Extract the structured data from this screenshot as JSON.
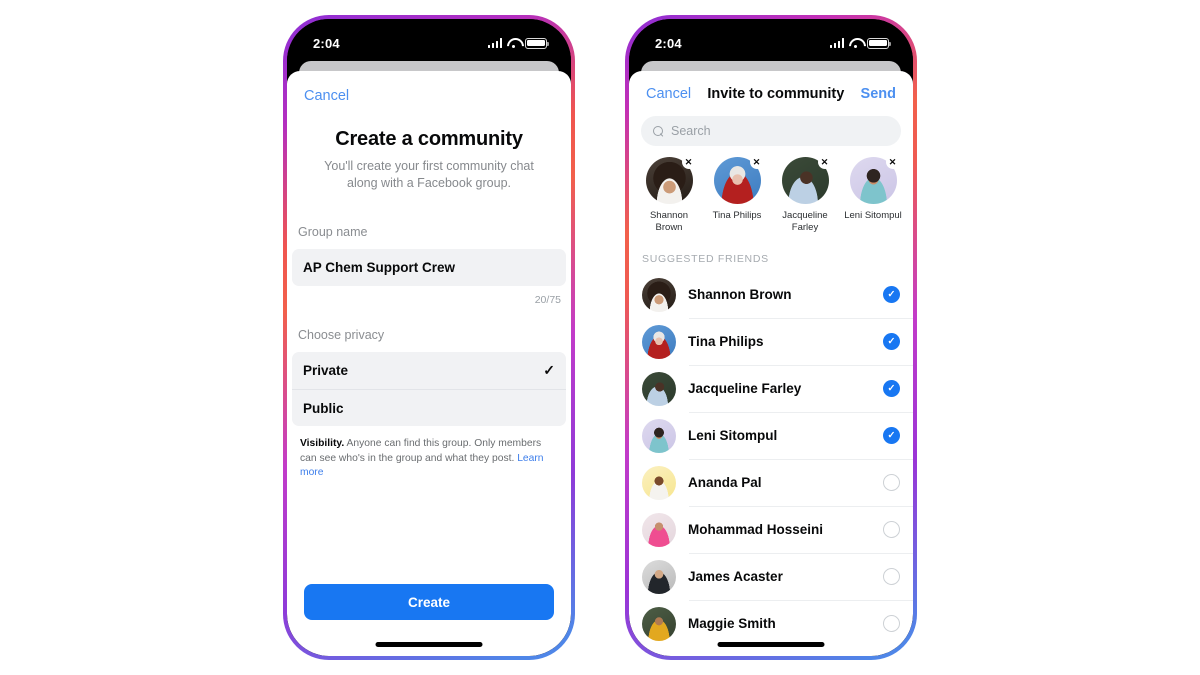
{
  "left_phone": {
    "status_bar": {
      "time": "2:04",
      "signal_icon": "cellular-bars-icon",
      "wifi_icon": "wifi-icon",
      "battery_icon": "battery-icon"
    },
    "nav": {
      "cancel_label": "Cancel"
    },
    "title": "Create a community",
    "subtitle": "You'll create your first community chat along with a Facebook group.",
    "group_name": {
      "label": "Group name",
      "value": "AP Chem Support Crew",
      "counter": "20/75"
    },
    "privacy": {
      "label": "Choose privacy",
      "options": [
        {
          "label": "Private",
          "selected": true,
          "check_glyph": "✓"
        },
        {
          "label": "Public",
          "selected": false,
          "check_glyph": ""
        }
      ]
    },
    "visibility_note": {
      "bold": "Visibility.",
      "text": " Anyone can find this group. Only members can see who's in the group and what they post. ",
      "link": "Learn more"
    },
    "primary_button": "Create",
    "accent_color": "#1877f2",
    "link_color": "#4d90f0"
  },
  "right_phone": {
    "status_bar": {
      "time": "2:04",
      "signal_icon": "cellular-bars-icon",
      "wifi_icon": "wifi-icon",
      "battery_icon": "battery-icon"
    },
    "nav": {
      "cancel_label": "Cancel",
      "title": "Invite to community",
      "send_label": "Send"
    },
    "search": {
      "placeholder": "Search",
      "icon": "search-icon"
    },
    "selected_chips": [
      {
        "name": "Shannon Brown",
        "remove_glyph": "✕",
        "avatar": "p1"
      },
      {
        "name": "Tina Philips",
        "remove_glyph": "✕",
        "avatar": "p2"
      },
      {
        "name": "Jacqueline Farley",
        "remove_glyph": "✕",
        "avatar": "p3"
      },
      {
        "name": "Leni Sitompul",
        "remove_glyph": "✕",
        "avatar": "p4"
      }
    ],
    "section_title": "SUGGESTED FRIENDS",
    "friends": [
      {
        "name": "Shannon Brown",
        "selected": true,
        "avatar": "p1",
        "check_glyph": "✓"
      },
      {
        "name": "Tina Philips",
        "selected": true,
        "avatar": "p2",
        "check_glyph": "✓"
      },
      {
        "name": "Jacqueline Farley",
        "selected": true,
        "avatar": "p3",
        "check_glyph": "✓"
      },
      {
        "name": "Leni Sitompul",
        "selected": true,
        "avatar": "p4",
        "check_glyph": "✓"
      },
      {
        "name": "Ananda Pal",
        "selected": false,
        "avatar": "p5",
        "check_glyph": ""
      },
      {
        "name": "Mohammad Hosseini",
        "selected": false,
        "avatar": "p6",
        "check_glyph": ""
      },
      {
        "name": "James Acaster",
        "selected": false,
        "avatar": "p7",
        "check_glyph": ""
      },
      {
        "name": "Maggie Smith",
        "selected": false,
        "avatar": "p8",
        "check_glyph": ""
      }
    ],
    "accent_color": "#1877f2",
    "link_color": "#4d90f0"
  }
}
